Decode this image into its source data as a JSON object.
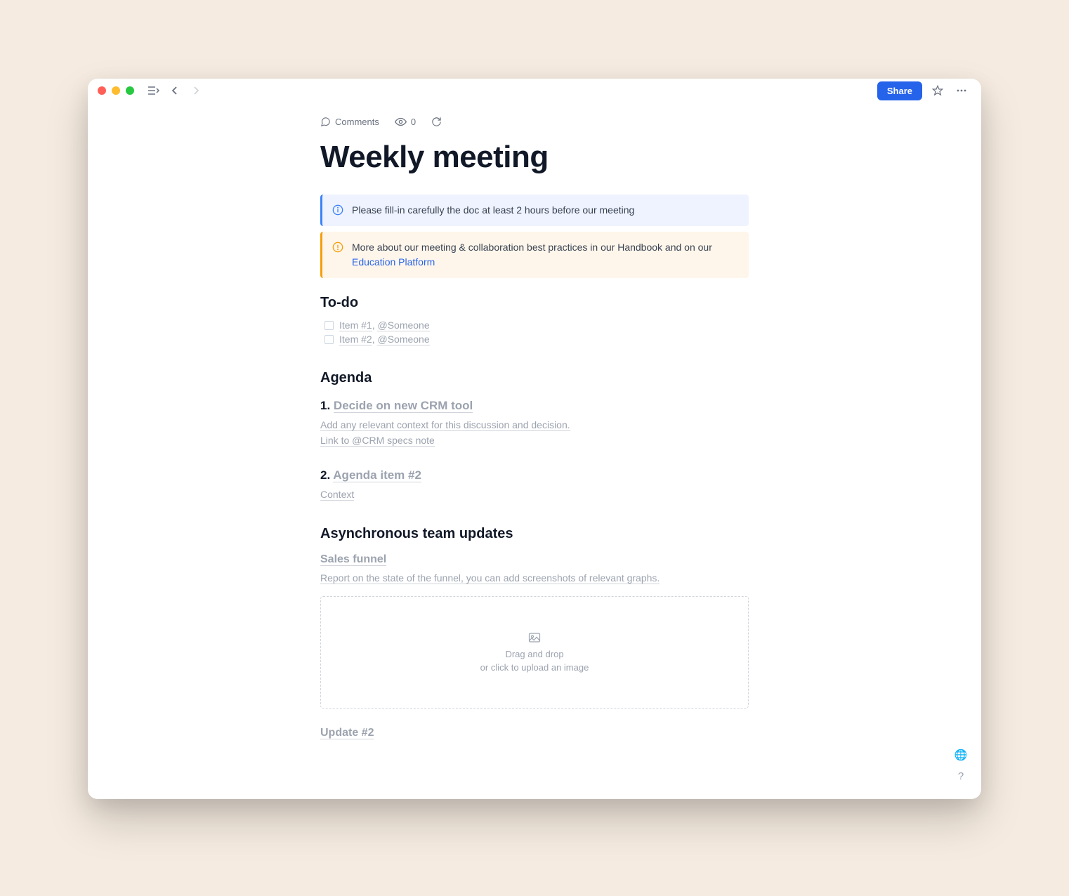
{
  "header": {
    "share_label": "Share"
  },
  "meta": {
    "comments_label": "Comments",
    "view_count": "0"
  },
  "title": "Weekly meeting",
  "banners": {
    "info_text": "Please fill-in carefully the doc at least 2 hours before our meeting",
    "warn_prefix": "More about our meeting & collaboration best practices in our Handbook and on our ",
    "warn_link": "Education Platform"
  },
  "todo": {
    "heading": "To-do",
    "items": [
      {
        "label": "Item #1",
        "mention": "@Someone"
      },
      {
        "label": "Item #2",
        "mention": "@Someone"
      }
    ]
  },
  "agenda": {
    "heading": "Agenda",
    "items": [
      {
        "num": "1.",
        "title": "Decide on new CRM tool",
        "lines": [
          "Add any relevant context for this discussion and decision.",
          "Link to @CRM specs note"
        ]
      },
      {
        "num": "2.",
        "title": "Agenda item #2",
        "lines": [
          "Context"
        ]
      }
    ]
  },
  "updates": {
    "heading": "Asynchronous team updates",
    "item1_title": "Sales funnel",
    "item1_body": "Report on the state of the funnel, you can add screenshots of relevant graphs.",
    "drop_line1": "Drag and drop",
    "drop_line2": "or click to upload an image",
    "item2_title": "Update #2"
  }
}
